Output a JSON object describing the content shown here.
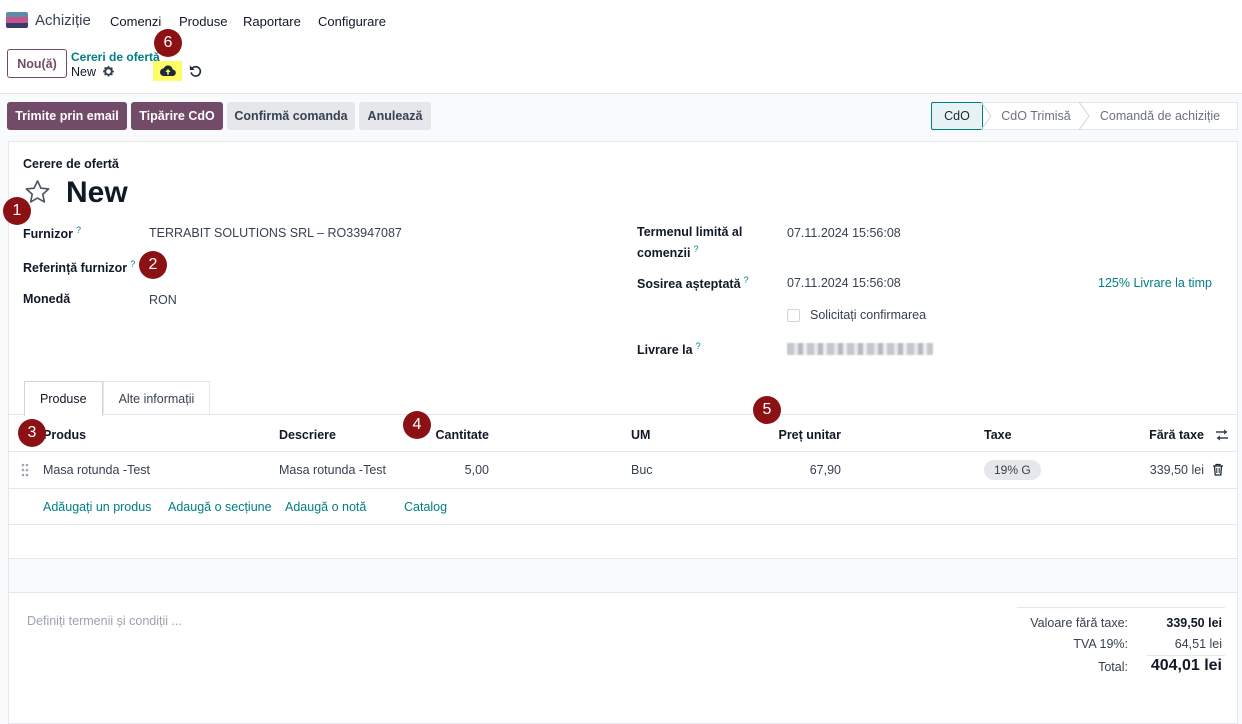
{
  "app": {
    "name": "Achiziție",
    "logo_colors": [
      "#5b8ea6",
      "#c6538c",
      "#3c3c6b"
    ]
  },
  "menu": [
    "Comenzi",
    "Produse",
    "Raportare",
    "Configurare"
  ],
  "control_panel": {
    "new_button": "Nou(ă)",
    "breadcrumb_parent": "Cereri de ofertă",
    "breadcrumb_current": "New",
    "icons": [
      "gear-icon",
      "cloud-upload-icon",
      "undo-icon"
    ]
  },
  "actions": {
    "send_email": "Trimite prin email",
    "print_rfq": "Tipărire CdO",
    "confirm_order": "Confirmă comanda",
    "cancel": "Anulează"
  },
  "statusbar": {
    "stages": [
      "CdO",
      "CdO Trimisă",
      "Comandă de achiziție"
    ],
    "current": "CdO"
  },
  "badges": [
    "1",
    "2",
    "3",
    "4",
    "5",
    "6"
  ],
  "form": {
    "record_type": "Cerere de ofertă",
    "title": "New",
    "vendor_label": "Furnizor",
    "vendor_value": "TERRABIT SOLUTIONS SRL – RO33947087",
    "vendor_ref_label": "Referință furnizor",
    "currency_label": "Monedă",
    "currency_value": "RON",
    "deadline_label_1": "Termenul limită al",
    "deadline_label_2": "comenzii",
    "deadline_value": "07.11.2024 15:56:08",
    "expected_arrival_label": "Sosirea așteptată",
    "expected_arrival_value": "07.11.2024 15:56:08",
    "on_time_link": "125% Livrare la timp",
    "ask_confirmation_label": "Solicitați confirmarea",
    "deliver_to_label": "Livrare la",
    "help_mark": "?"
  },
  "tabs": [
    "Produse",
    "Alte informații"
  ],
  "order_lines": {
    "headers": {
      "product": "Produs",
      "description": "Descriere",
      "quantity": "Cantitate",
      "uom": "UM",
      "unit_price": "Preț unitar",
      "taxes": "Taxe",
      "subtotal": "Fără taxe"
    },
    "rows": [
      {
        "product": "Masa rotunda -Test",
        "description": "Masa rotunda -Test",
        "quantity": "5,00",
        "uom": "Buc",
        "unit_price": "67,90",
        "taxes": "19% G",
        "subtotal": "339,50 lei"
      }
    ],
    "add_links": [
      "Adăugați un produs",
      "Adaugă o secțiune",
      "Adaugă o notă",
      "Catalog"
    ]
  },
  "terms_placeholder": "Definiți termenii și condiții ...",
  "totals": {
    "untaxed_label": "Valoare fără taxe:",
    "untaxed_value": "339,50 lei",
    "vat_label": "TVA 19%:",
    "vat_value": "64,51 lei",
    "total_label": "Total:",
    "total_value": "404,01 lei"
  }
}
